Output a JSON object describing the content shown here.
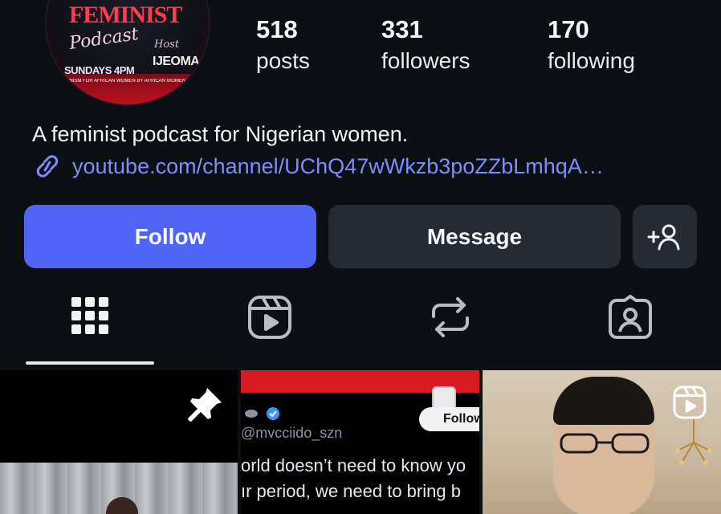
{
  "profile": {
    "avatar": {
      "title": "FEMINIST",
      "script": "Podcast",
      "host_label": "Host",
      "host_name": "IJEOMA",
      "schedule": "SUNDAYS 4PM",
      "tagline": "FEMINISM FOR AFRICAN WOMEN BY AFRICAN WOMEN"
    },
    "stats": {
      "posts": {
        "value": "518",
        "label": "posts"
      },
      "followers": {
        "value": "331",
        "label": "followers"
      },
      "following": {
        "value": "170",
        "label": "following"
      }
    },
    "bio": "A feminist podcast for Nigerian women.",
    "link": "youtube.com/channel/UChQ47wWkzb3poZZbLmhqA…"
  },
  "actions": {
    "follow_label": "Follow",
    "message_label": "Message",
    "add_person_icon": "add-person-icon",
    "follow_color": "#4f63f5"
  },
  "tabs": [
    {
      "icon": "grid-icon",
      "active": true
    },
    {
      "icon": "reels-icon",
      "active": false
    },
    {
      "icon": "repost-icon",
      "active": false
    },
    {
      "icon": "tagged-icon",
      "active": false
    }
  ],
  "grid": {
    "tile1": {
      "pinned": true,
      "icon": "pin-icon"
    },
    "tile2": {
      "handle": "@mvcciido_szn",
      "follow_label": "Follow",
      "line1": "orld doesn’t need to know yo",
      "line2": "ır period, we need to bring b"
    },
    "tile3": {
      "icon": "reels-icon"
    }
  }
}
